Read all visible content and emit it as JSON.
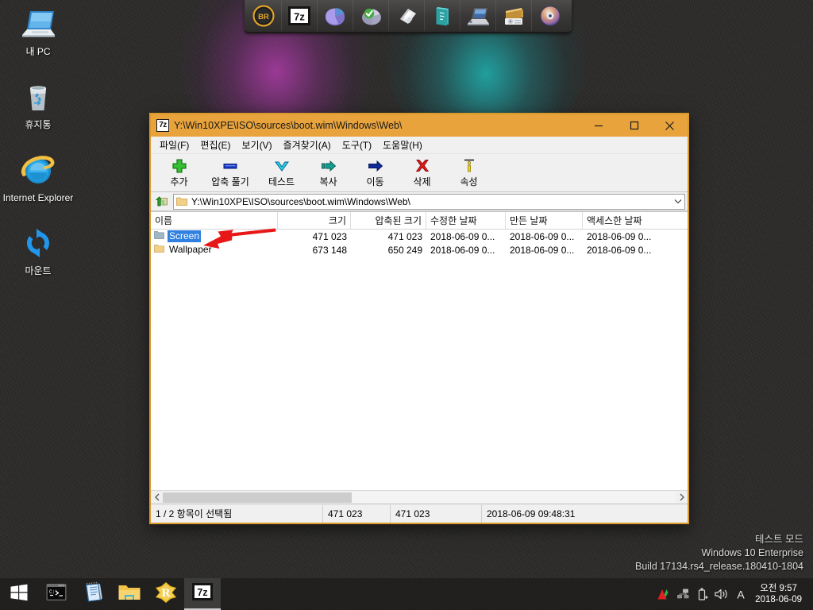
{
  "desktop": {
    "icons": [
      {
        "label": "내 PC",
        "icon": "my-computer-icon"
      },
      {
        "label": "휴지통",
        "icon": "recycle-bin-icon"
      },
      {
        "label": "Internet Explorer",
        "icon": "internet-explorer-icon"
      },
      {
        "label": "마운트",
        "icon": "mount-refresh-icon"
      }
    ],
    "watermark": {
      "line1": "테스트 모드",
      "line2": "Windows 10 Enterprise",
      "line3": "Build 17134.rs4_release.180410-1804"
    },
    "background_color": "#2b2a29",
    "glow_purple": "#c43ebe",
    "glow_teal": "#1ebebe"
  },
  "top_dock": {
    "items": [
      {
        "name": "br-tool",
        "icon": "br-badge-icon"
      },
      {
        "name": "seven-zip",
        "icon": "7z-icon"
      },
      {
        "name": "partition-manager",
        "icon": "purple-pie-disk-icon"
      },
      {
        "name": "disk-checker",
        "icon": "green-check-pie-icon"
      },
      {
        "name": "save-image-tool",
        "icon": "floppy-disk-icon"
      },
      {
        "name": "notes-tool",
        "icon": "teal-book-icon"
      },
      {
        "name": "network-computer",
        "icon": "laptop-network-icon"
      },
      {
        "name": "backup-tool",
        "icon": "tape-drive-icon"
      },
      {
        "name": "cd-burner",
        "icon": "cd-disc-icon"
      }
    ]
  },
  "window": {
    "title": "Y:\\Win10XPE\\ISO\\sources\\boot.wim\\Windows\\Web\\",
    "app_icon_label": "7z",
    "titlebar_color": "#e8a33d",
    "controls": {
      "minimize": "minimize-icon",
      "maximize": "maximize-icon",
      "close": "close-icon"
    },
    "menu": [
      "파일(F)",
      "편집(E)",
      "보기(V)",
      "즐겨찾기(A)",
      "도구(T)",
      "도움말(H)"
    ],
    "toolbar": [
      {
        "label": "추가",
        "icon": "plus-add-icon"
      },
      {
        "label": "압축 풀기",
        "icon": "extract-bar-icon"
      },
      {
        "label": "테스트",
        "icon": "chevron-down-test-icon"
      },
      {
        "label": "복사",
        "icon": "copy-arrow-icon"
      },
      {
        "label": "이동",
        "icon": "move-arrow-icon"
      },
      {
        "label": "삭제",
        "icon": "red-x-delete-icon"
      },
      {
        "label": "속성",
        "icon": "info-properties-icon"
      }
    ],
    "address": {
      "value": "Y:\\Win10XPE\\ISO\\sources\\boot.wim\\Windows\\Web\\",
      "up_icon": "up-folder-icon",
      "folder_icon": "folder-icon",
      "dropdown_icon": "chevron-down-icon"
    },
    "columns": [
      "이름",
      "크기",
      "압축된 크기",
      "수정한 날짜",
      "만든 날짜",
      "액세스한 날짜"
    ],
    "rows": [
      {
        "name": "Screen",
        "size": "471 023",
        "packed_size": "471 023",
        "modified": "2018-06-09 0...",
        "created": "2018-06-09 0...",
        "accessed": "2018-06-09 0...",
        "selected": true,
        "icon": "folder-icon-selected"
      },
      {
        "name": "Wallpaper",
        "size": "673 148",
        "packed_size": "650 249",
        "modified": "2018-06-09 0...",
        "created": "2018-06-09 0...",
        "accessed": "2018-06-09 0...",
        "selected": false,
        "icon": "folder-icon"
      }
    ],
    "statusbar": {
      "selection": "1 / 2 항목이 선택됨",
      "size": "471 023",
      "packed_size": "471 023",
      "timestamp": "2018-06-09 09:48:31"
    },
    "selection_color": "#2f80e0"
  },
  "annotation": {
    "arrow_color": "#e81818",
    "arrow_name": "red-pointer-arrow"
  },
  "taskbar": {
    "start": {
      "icon": "windows-start-icon"
    },
    "buttons": [
      {
        "name": "command-prompt",
        "icon": "cmd-console-icon",
        "active": false
      },
      {
        "name": "notepad",
        "icon": "notepad-icon",
        "active": false
      },
      {
        "name": "file-explorer",
        "icon": "folder-explorer-icon",
        "active": false
      },
      {
        "name": "registry-workshop",
        "icon": "r-badge-icon",
        "active": false
      },
      {
        "name": "seven-zip",
        "icon": "7z-icon",
        "active": true
      }
    ],
    "tray": [
      {
        "name": "antivirus",
        "icon": "ahnlab-triangle-icon"
      },
      {
        "name": "network",
        "icon": "network-icon"
      },
      {
        "name": "safely-remove-hardware",
        "icon": "usb-eject-icon"
      },
      {
        "name": "volume",
        "icon": "speaker-icon"
      },
      {
        "name": "input-method",
        "icon": "ime-a-icon"
      }
    ],
    "clock": {
      "time": "오전 9:57",
      "date": "2018-06-09"
    }
  }
}
